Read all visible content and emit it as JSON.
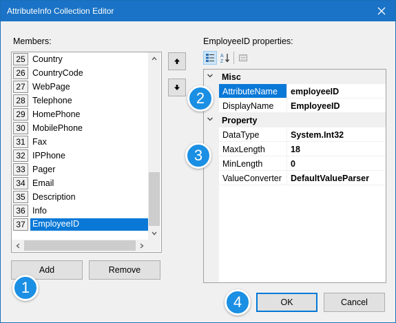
{
  "window": {
    "title": "AttributeInfo Collection Editor"
  },
  "members": {
    "label": "Members:",
    "items": [
      {
        "index": "25",
        "name": "Country"
      },
      {
        "index": "26",
        "name": "CountryCode"
      },
      {
        "index": "27",
        "name": "WebPage"
      },
      {
        "index": "28",
        "name": "Telephone"
      },
      {
        "index": "29",
        "name": "HomePhone"
      },
      {
        "index": "30",
        "name": "MobilePhone"
      },
      {
        "index": "31",
        "name": "Fax"
      },
      {
        "index": "32",
        "name": "IPPhone"
      },
      {
        "index": "33",
        "name": "Pager"
      },
      {
        "index": "34",
        "name": "Email"
      },
      {
        "index": "35",
        "name": "Description"
      },
      {
        "index": "36",
        "name": "Info"
      },
      {
        "index": "37",
        "name": "EmployeeID"
      }
    ],
    "selected": "EmployeeID"
  },
  "buttons": {
    "add": "Add",
    "remove": "Remove",
    "ok": "OK",
    "cancel": "Cancel"
  },
  "properties": {
    "label": "EmployeeID properties:",
    "categories": [
      {
        "name": "Misc",
        "rows": [
          {
            "name": "AttributeName",
            "value": "employeeID",
            "selected": true
          },
          {
            "name": "DisplayName",
            "value": "EmployeeID"
          }
        ]
      },
      {
        "name": "Property",
        "rows": [
          {
            "name": "DataType",
            "value": "System.Int32"
          },
          {
            "name": "MaxLength",
            "value": "18"
          },
          {
            "name": "MinLength",
            "value": "0"
          },
          {
            "name": "ValueConverter",
            "value": "DefaultValueParser"
          }
        ]
      }
    ]
  },
  "callouts": [
    "1",
    "2",
    "3",
    "4"
  ],
  "colors": {
    "titlebar": "#1a73c6",
    "selection": "#0a78d7",
    "callout": "#1a8fe3",
    "dialog_bg": "#f0f0f0"
  },
  "icons": {
    "close": "close-icon",
    "move_up": "arrow-up-icon",
    "move_down": "arrow-down-icon",
    "categorized": "categorized-icon",
    "alphabetical": "sort-az-icon",
    "property_pages": "property-pages-icon"
  }
}
